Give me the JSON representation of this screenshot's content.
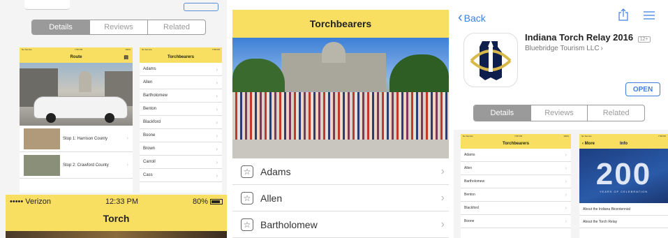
{
  "panel1": {
    "tabs": [
      "Details",
      "Reviews",
      "Related"
    ],
    "left_phone": {
      "status_carrier": "No Service",
      "status_time": "7:58 PM",
      "status_battery": "100%",
      "title": "Route",
      "stops": [
        {
          "label": "Stop 1: Harrison County"
        },
        {
          "label": "Stop 2: Crawford County"
        }
      ]
    },
    "right_phone": {
      "status_carrier": "No Service",
      "status_time": "7:58 PM",
      "title": "Torchbearers",
      "items": [
        "Adams",
        "Allen",
        "Bartholomew",
        "Benton",
        "Blackford",
        "Boone",
        "Brown",
        "Carroll",
        "Cass"
      ]
    },
    "bottom_phone": {
      "carrier": "••••• Verizon",
      "time": "12:33 PM",
      "battery": "80%",
      "title": "Torch"
    }
  },
  "panel2": {
    "title": "Torchbearers",
    "items": [
      "Adams",
      "Allen",
      "Bartholomew"
    ]
  },
  "panel3": {
    "back_label": "Back",
    "app_name": "Indiana Torch Relay 2016",
    "age_badge": "12+",
    "developer": "Bluebridge Tourism LLC",
    "open_label": "OPEN",
    "tabs": [
      "Details",
      "Reviews",
      "Related"
    ],
    "left_phone": {
      "status_carrier": "No Service",
      "status_time": "7:58 PM",
      "status_battery": "100%",
      "title": "Torchbearers",
      "items": [
        "Adams",
        "Allen",
        "Bartholomew",
        "Benton",
        "Blackford",
        "Boone"
      ]
    },
    "right_phone": {
      "status_carrier": "No Service",
      "status_time": "7:58 PM",
      "more_label": "More",
      "title": "Info",
      "banner": "200",
      "banner_sub": "YEARS OF CELEBRATION",
      "links": [
        "About the Indiana Bicentennial",
        "About the Torch Relay"
      ]
    }
  },
  "colors": {
    "accent_yellow": "#f8df62",
    "ios_blue": "#3b7fe0"
  }
}
